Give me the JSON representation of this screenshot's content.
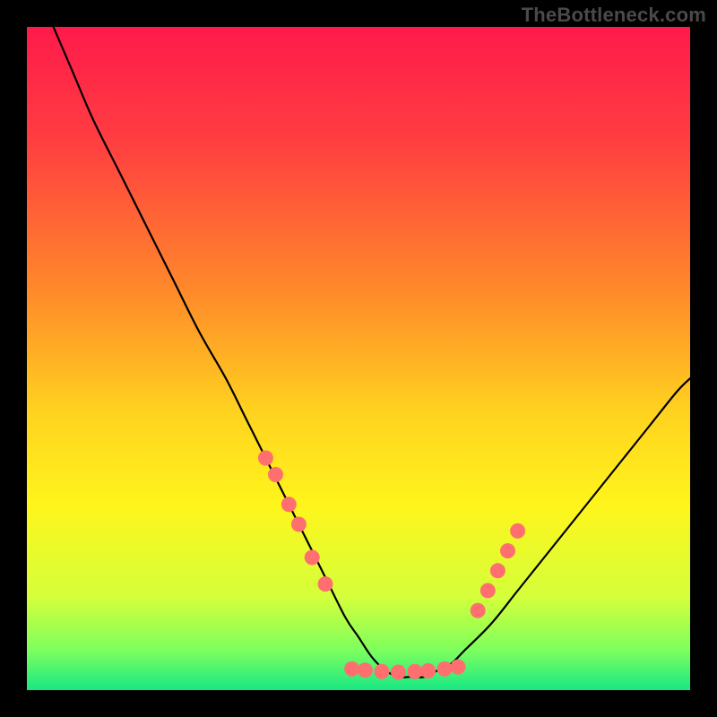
{
  "watermark": "TheBottleneck.com",
  "chart_data": {
    "type": "line",
    "title": "",
    "xlabel": "",
    "ylabel": "",
    "xlim": [
      0,
      100
    ],
    "ylim": [
      0,
      100
    ],
    "gradient_stops": [
      {
        "offset": 0,
        "color": "#ff1a4b"
      },
      {
        "offset": 18,
        "color": "#ff4040"
      },
      {
        "offset": 40,
        "color": "#ff8a2a"
      },
      {
        "offset": 58,
        "color": "#ffd21f"
      },
      {
        "offset": 72,
        "color": "#fff51c"
      },
      {
        "offset": 86,
        "color": "#d4ff3a"
      },
      {
        "offset": 94,
        "color": "#7dff5e"
      },
      {
        "offset": 100,
        "color": "#18e884"
      }
    ],
    "series": [
      {
        "name": "curve",
        "color": "#000000",
        "x": [
          4,
          7,
          10,
          14,
          18,
          22,
          26,
          30,
          33,
          36,
          39,
          42,
          45,
          48,
          50,
          52,
          54,
          56,
          58,
          60,
          62,
          64,
          66,
          70,
          74,
          78,
          82,
          86,
          90,
          94,
          98,
          100
        ],
        "y": [
          100,
          93,
          86,
          78,
          70,
          62,
          54,
          47,
          41,
          35,
          29,
          23,
          17,
          11,
          8,
          5,
          3,
          2,
          2,
          2,
          3,
          4,
          6,
          10,
          15,
          20,
          25,
          30,
          35,
          40,
          45,
          47
        ]
      }
    ],
    "markers": [
      {
        "x": 36,
        "y": 35,
        "color": "#ff6f6f"
      },
      {
        "x": 37.5,
        "y": 32.5,
        "color": "#ff6f6f"
      },
      {
        "x": 39.5,
        "y": 28,
        "color": "#ff6f6f"
      },
      {
        "x": 41,
        "y": 25,
        "color": "#ff6f6f"
      },
      {
        "x": 43,
        "y": 20,
        "color": "#ff6f6f"
      },
      {
        "x": 45,
        "y": 16,
        "color": "#ff6f6f"
      },
      {
        "x": 49,
        "y": 3.2,
        "color": "#ff6f6f"
      },
      {
        "x": 51,
        "y": 3.0,
        "color": "#ff6f6f"
      },
      {
        "x": 53.5,
        "y": 2.8,
        "color": "#ff6f6f"
      },
      {
        "x": 56,
        "y": 2.7,
        "color": "#ff6f6f"
      },
      {
        "x": 58.5,
        "y": 2.8,
        "color": "#ff6f6f"
      },
      {
        "x": 60.5,
        "y": 2.9,
        "color": "#ff6f6f"
      },
      {
        "x": 63,
        "y": 3.2,
        "color": "#ff6f6f"
      },
      {
        "x": 65,
        "y": 3.5,
        "color": "#ff6f6f"
      },
      {
        "x": 68,
        "y": 12,
        "color": "#ff6f6f"
      },
      {
        "x": 69.5,
        "y": 15,
        "color": "#ff6f6f"
      },
      {
        "x": 71,
        "y": 18,
        "color": "#ff6f6f"
      },
      {
        "x": 72.5,
        "y": 21,
        "color": "#ff6f6f"
      },
      {
        "x": 74,
        "y": 24,
        "color": "#ff6f6f"
      }
    ],
    "marker_radius": 8.5
  }
}
